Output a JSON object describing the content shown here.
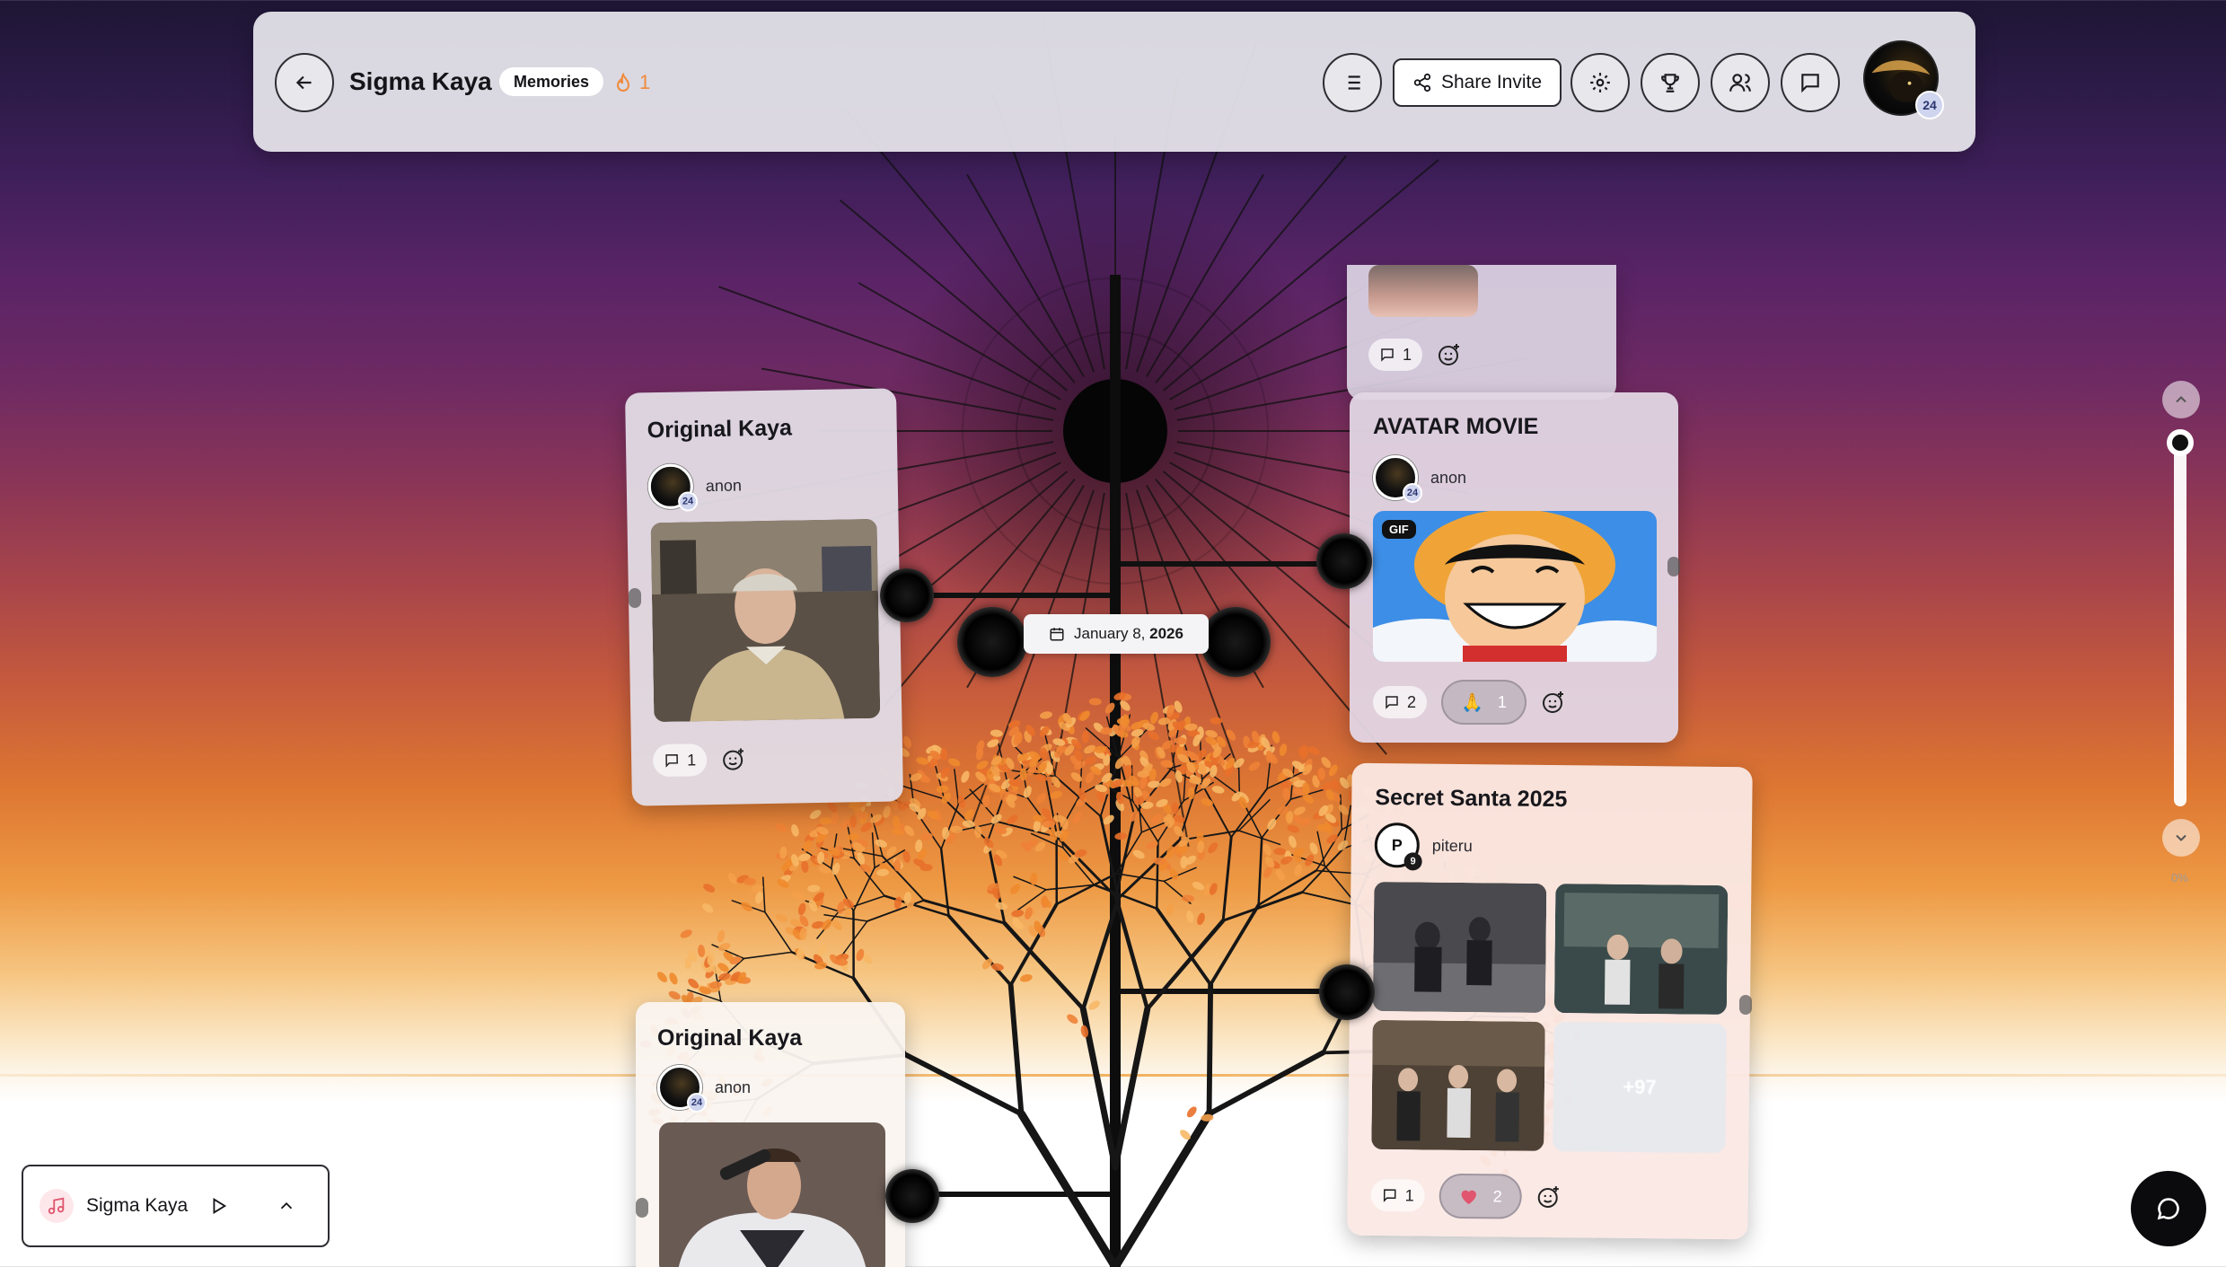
{
  "header": {
    "title": "Sigma Kaya",
    "memories_badge": "Memories",
    "streak_count": "1",
    "share_label": "Share Invite",
    "avatar_count": "24"
  },
  "timeline": {
    "date_prefix": "January 8,",
    "date_year": "2026"
  },
  "cards": {
    "top_partial": {
      "comments": "1"
    },
    "original_kaya_1": {
      "title": "Original Kaya",
      "author": "anon",
      "author_count": "24",
      "comments": "1"
    },
    "avatar_movie": {
      "title": "AVATAR MOVIE",
      "author": "anon",
      "author_count": "24",
      "gif_label": "GIF",
      "comments": "2",
      "reaction_count": "1"
    },
    "secret_santa": {
      "title": "Secret Santa 2025",
      "author": "piteru",
      "author_initial": "P",
      "author_count": "9",
      "more_count": "+97",
      "comments": "1",
      "reaction_count": "2"
    },
    "original_kaya_2": {
      "title": "Original Kaya",
      "author": "anon",
      "author_count": "24"
    }
  },
  "scroll": {
    "percent": "0%"
  },
  "music": {
    "title": "Sigma Kaya"
  },
  "colors": {
    "accent_streak": "#f08a3c",
    "heart": "#e0566e",
    "badge_bg": "#cfd5ee"
  }
}
